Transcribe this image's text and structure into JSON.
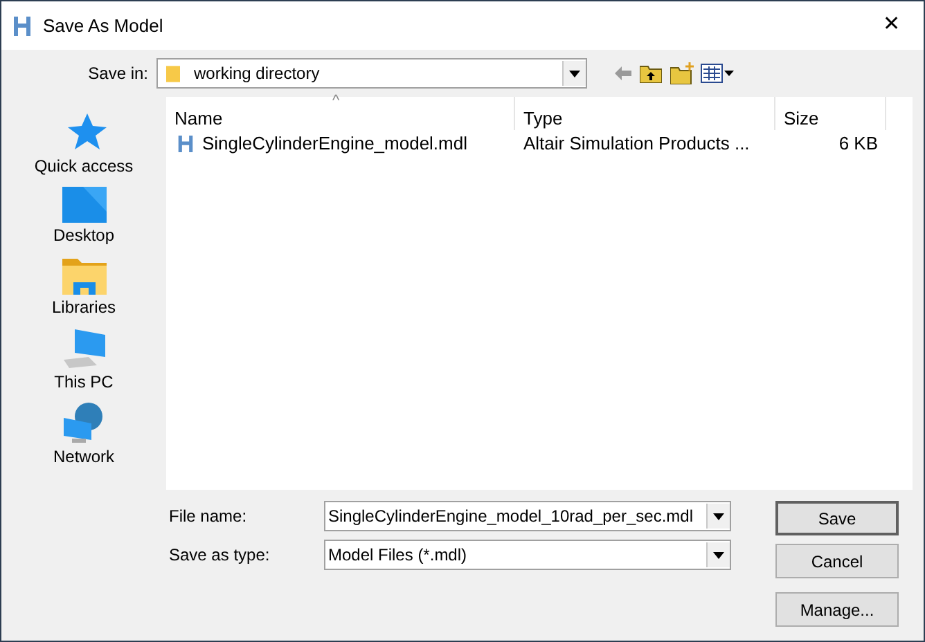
{
  "window": {
    "title": "Save As Model",
    "close": "✕"
  },
  "save_in": {
    "label": "Save in:",
    "value": "working directory"
  },
  "sidebar": {
    "items": [
      {
        "kind": "star",
        "label": "Quick access"
      },
      {
        "kind": "desktop",
        "label": "Desktop"
      },
      {
        "kind": "libraries",
        "label": "Libraries"
      },
      {
        "kind": "pc",
        "label": "This PC"
      },
      {
        "kind": "network",
        "label": "Network"
      }
    ]
  },
  "table": {
    "sort_mark": "^",
    "columns": [
      "Name",
      "Type",
      "Size"
    ],
    "rows": [
      {
        "name": "SingleCylinderEngine_model.mdl",
        "type": "Altair Simulation Products ...",
        "size": "6 KB",
        "selected": false
      }
    ]
  },
  "file_name": {
    "label": "File name:",
    "value": "SingleCylinderEngine_model_10rad_per_sec.mdl"
  },
  "save_as_type": {
    "label": "Save as type:",
    "value": "Model Files (*.mdl)"
  },
  "buttons": [
    "Save",
    "Cancel",
    "Manage..."
  ]
}
